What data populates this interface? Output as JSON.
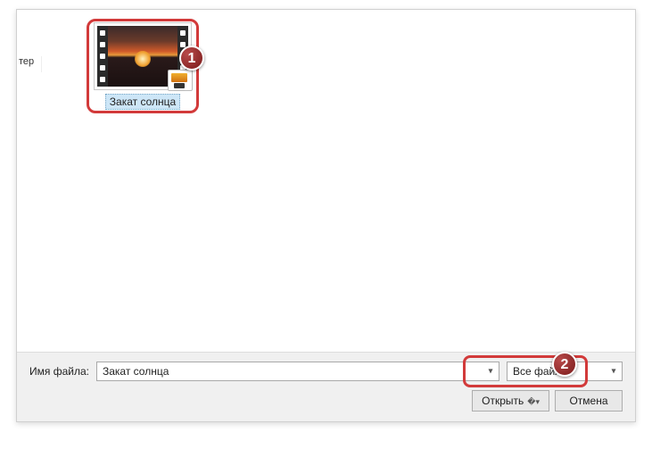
{
  "sidebar": {
    "fragment_text": "тер"
  },
  "file": {
    "label": "Закат солнца",
    "icon_name": "video-file-icon"
  },
  "badges": {
    "one": "1",
    "two": "2"
  },
  "bottom": {
    "filename_label": "Имя файла:",
    "filename_value": "Закат солнца",
    "filter_value": "Все файлы",
    "open_label": "Открыть",
    "cancel_label": "Отмена"
  }
}
